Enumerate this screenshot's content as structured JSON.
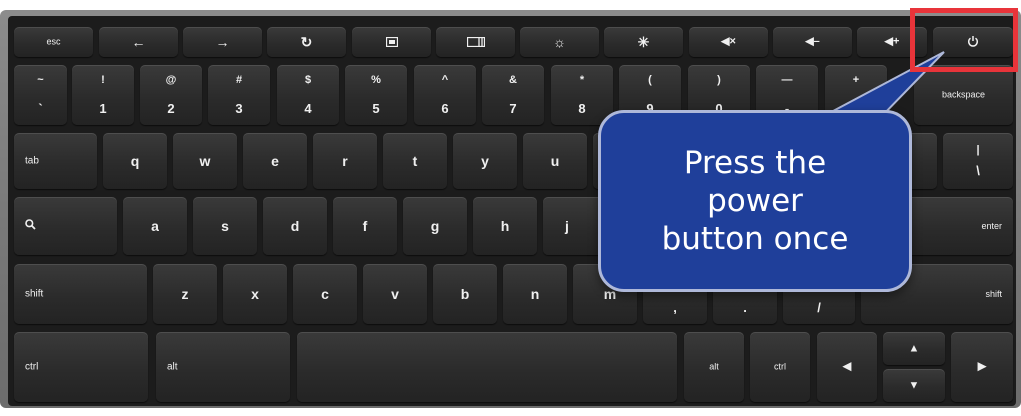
{
  "keys": {
    "esc": "esc",
    "tilde": "~",
    "grave": "`",
    "n1_top": "!",
    "n1": "1",
    "n2_top": "@",
    "n2": "2",
    "n3_top": "#",
    "n3": "3",
    "n4_top": "$",
    "n4": "4",
    "n5_top": "%",
    "n5": "5",
    "n6_top": "^",
    "n6": "6",
    "n7_top": "&",
    "n7": "7",
    "n8_top": "*",
    "n8": "8",
    "n9_top": "(",
    "n9": "9",
    "n0_top": ")",
    "n0": "0",
    "minus_top": "—",
    "minus": "-",
    "plus_top": "+",
    "equals": "=",
    "backspace": "backspace",
    "tab": "tab",
    "q": "q",
    "w": "w",
    "e": "e",
    "r": "r",
    "t": "t",
    "y": "y",
    "u": "u",
    "pipe": "|",
    "backslash": "\\",
    "a": "a",
    "s": "s",
    "d": "d",
    "f": "f",
    "g": "g",
    "h": "h",
    "j": "j",
    "enter": "enter",
    "shift": "shift",
    "z": "z",
    "x": "x",
    "c": "c",
    "v": "v",
    "b": "b",
    "n": "n",
    "m": "m",
    "comma": ",",
    "period": ".",
    "slash": "/",
    "ctrl": "ctrl",
    "alt": "alt"
  },
  "icons": {
    "back": "back-arrow-icon",
    "forward": "forward-arrow-icon",
    "refresh": "refresh-icon",
    "fullscreen": "fullscreen-icon",
    "overview": "overview-icon",
    "brightness_down": "brightness-down-icon",
    "brightness_up": "brightness-up-icon",
    "mute": "mute-icon",
    "volume_down": "volume-down-icon",
    "volume_up": "volume-up-icon",
    "power": "power-icon",
    "search": "search-icon"
  },
  "callout": {
    "line1": "Press the",
    "line2": "power",
    "line3": "button once"
  },
  "colors": {
    "callout_fill": "#1f3f9a",
    "highlight": "#e8343a",
    "key": "#2b2b2b",
    "frame": "#7a7a7a"
  }
}
